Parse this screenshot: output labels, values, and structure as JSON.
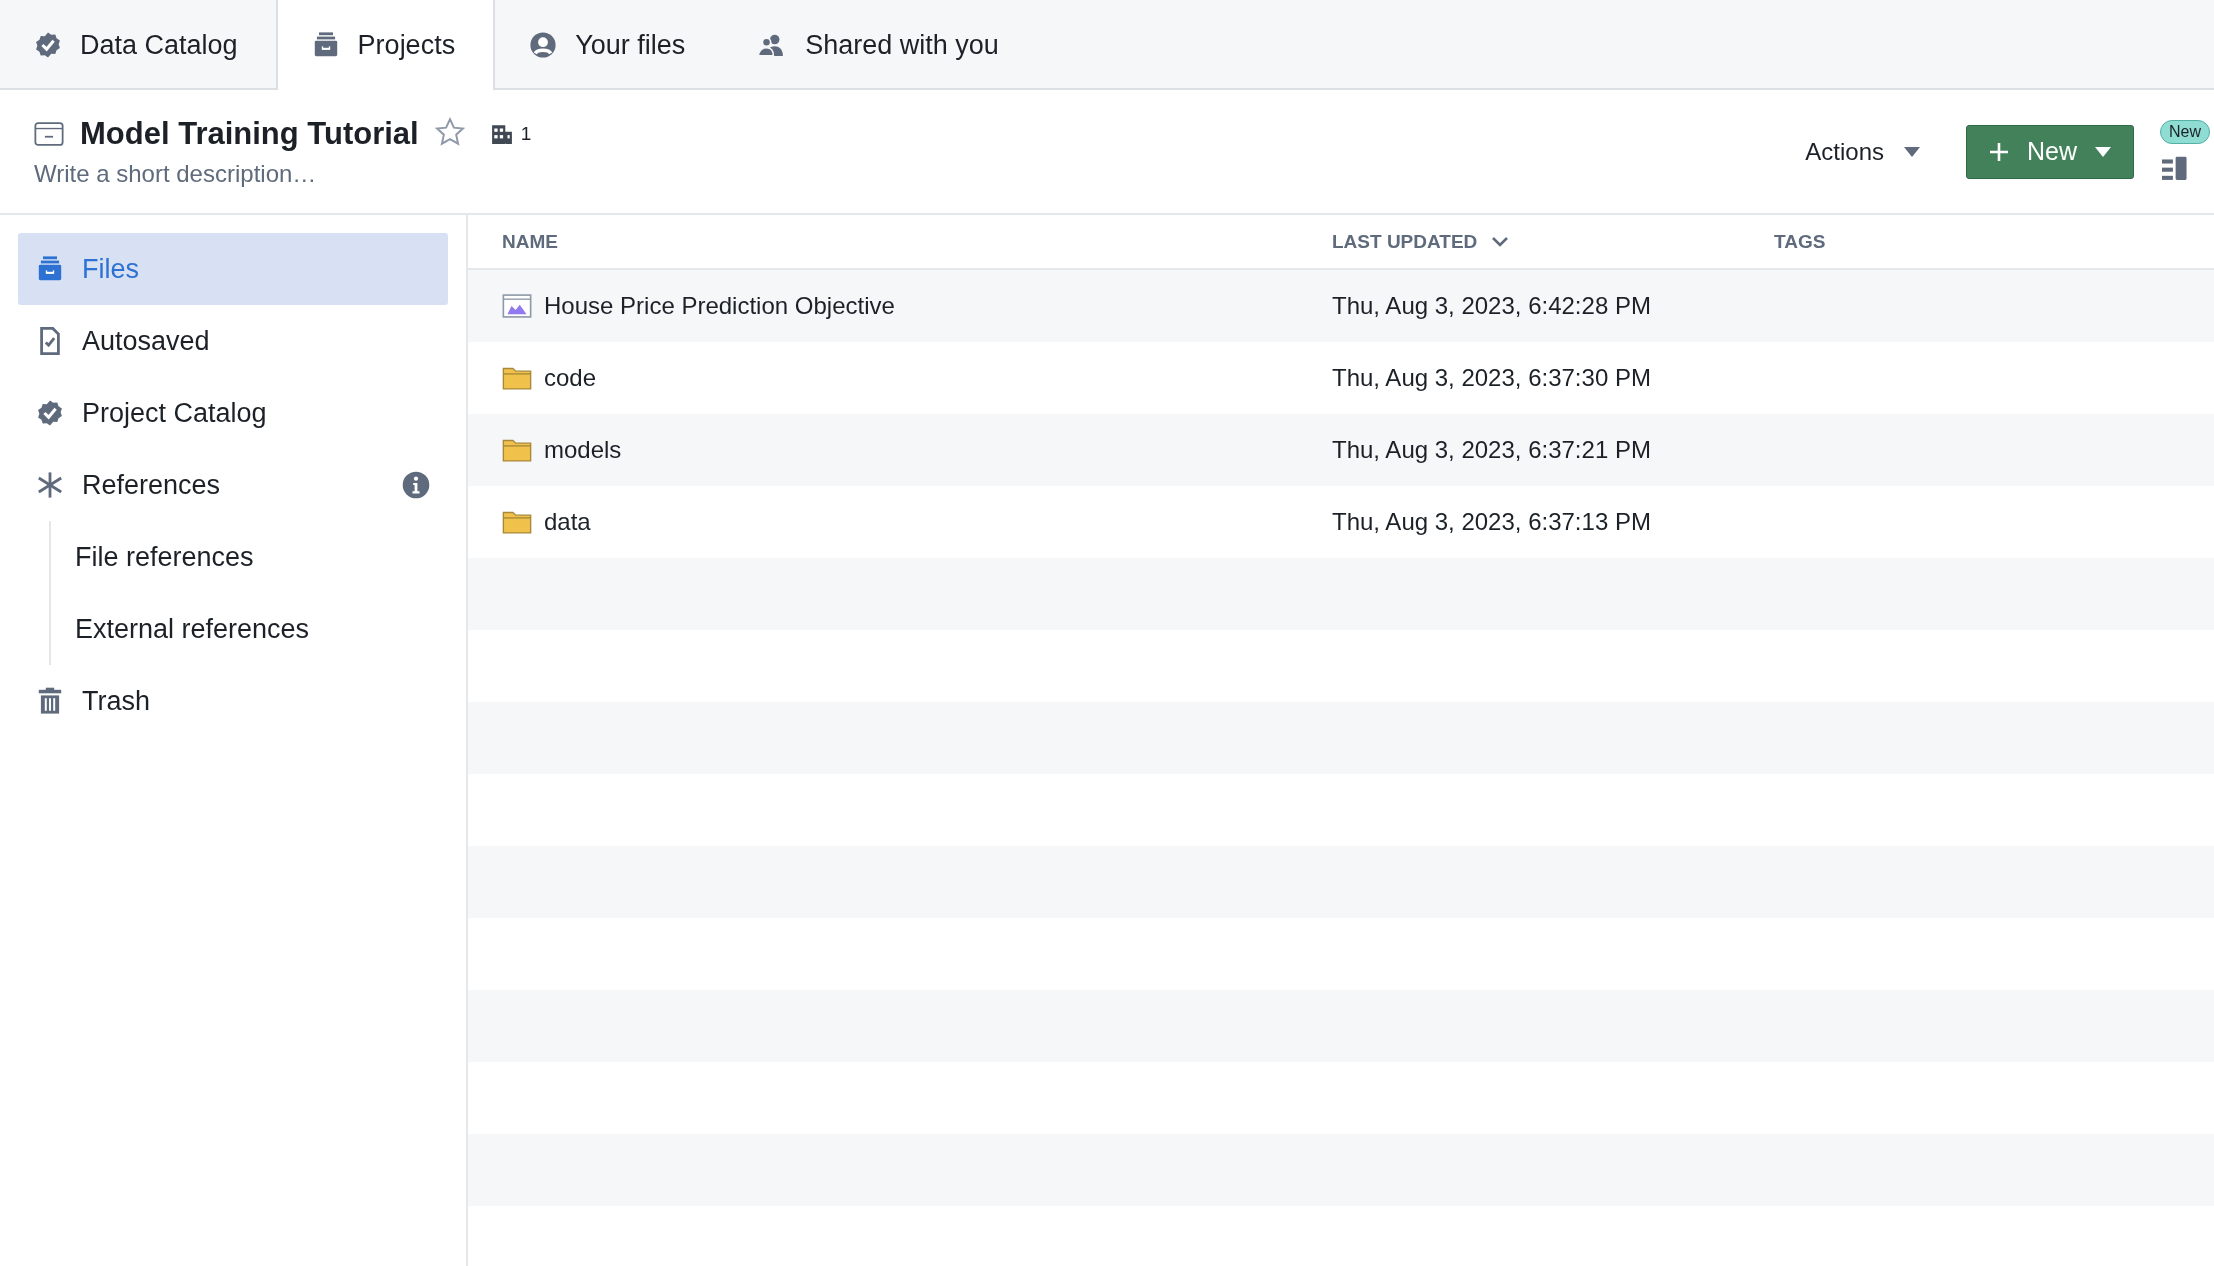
{
  "tabs": [
    {
      "label": "Data Catalog",
      "kind": "catalog",
      "selected": false
    },
    {
      "label": "Projects",
      "kind": "projects",
      "selected": true
    },
    {
      "label": "Your files",
      "kind": "user",
      "selected": false
    },
    {
      "label": "Shared with you",
      "kind": "shared",
      "selected": false
    }
  ],
  "project": {
    "title": "Model Training Tutorial",
    "starred": false,
    "member_count": "1",
    "description": {
      "placeholder": "Write a short description…"
    }
  },
  "toolbar": {
    "actions": "Actions",
    "new_button": "New",
    "new_badge": "New"
  },
  "sidebar": {
    "items": [
      {
        "label": "Files",
        "kind": "files",
        "selected": true,
        "info": false
      },
      {
        "label": "Autosaved",
        "kind": "autosaved",
        "selected": false,
        "info": false
      },
      {
        "label": "Project Catalog",
        "kind": "catalog",
        "selected": false,
        "info": false
      },
      {
        "label": "References",
        "kind": "references",
        "selected": false,
        "info": true,
        "children": [
          {
            "label": "File references",
            "selected": false
          },
          {
            "label": "External references",
            "selected": false
          }
        ]
      },
      {
        "label": "Trash",
        "kind": "trash",
        "selected": false,
        "info": false
      }
    ]
  },
  "table": {
    "columns": [
      {
        "label": "NAME",
        "sorted": false
      },
      {
        "label": "LAST UPDATED",
        "sorted": true
      },
      {
        "label": "TAGS",
        "sorted": false
      }
    ],
    "rows": [
      {
        "name": "House Price Prediction Objective",
        "kind": "objective",
        "last_updated": "Thu, Aug 3, 2023, 6:42:28 PM"
      },
      {
        "name": "code",
        "kind": "folder",
        "last_updated": "Thu, Aug 3, 2023, 6:37:30 PM"
      },
      {
        "name": "models",
        "kind": "folder",
        "last_updated": "Thu, Aug 3, 2023, 6:37:21 PM"
      },
      {
        "name": "data",
        "kind": "folder",
        "last_updated": "Thu, Aug 3, 2023, 6:37:13 PM"
      }
    ]
  }
}
